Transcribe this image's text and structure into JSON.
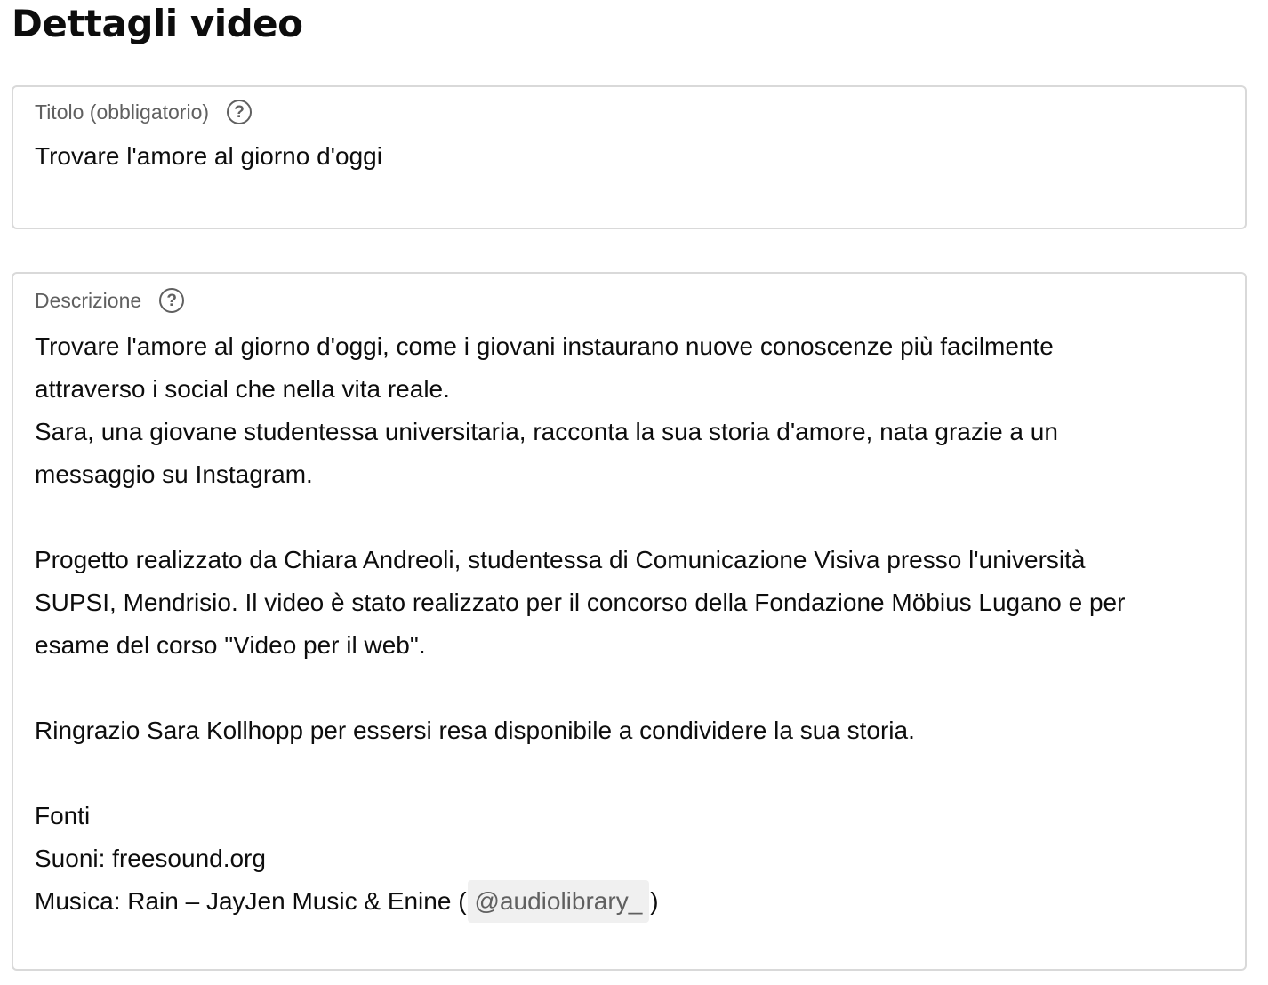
{
  "page": {
    "title": "Dettagli video"
  },
  "title_field": {
    "label": "Titolo (obbligatorio)",
    "value": "Trovare l'amore al giorno d'oggi"
  },
  "description_field": {
    "label": "Descrizione",
    "lines": [
      "Trovare l'amore al giorno d'oggi, come i giovani instaurano nuove conoscenze più facilmente",
      "attraverso i social che nella vita reale.",
      "Sara, una giovane studentessa universitaria, racconta la sua storia d'amore, nata grazie a un",
      "messaggio su Instagram.",
      "",
      "Progetto realizzato da Chiara Andreoli, studentessa di Comunicazione Visiva presso l'università",
      "SUPSI, Mendrisio. Il video è stato realizzato per il concorso della Fondazione Möbius Lugano e per",
      "esame del corso \"Video per il web\".",
      "",
      "Ringrazio Sara Kollhopp per essersi resa disponibile a condividere la sua storia.",
      "",
      "Fonti",
      "Suoni: freesound.org"
    ],
    "music_prefix": "Musica: Rain – JayJen Music & Enine (",
    "music_mention": "@audiolibrary_",
    "music_suffix": ")"
  },
  "icons": {
    "help": "help-circle-icon",
    "help_glyph": "?"
  },
  "colors": {
    "text": "#0d0d0d",
    "label": "#606060",
    "border": "#d9d9d9",
    "mention_bg": "#f0f0f0"
  }
}
